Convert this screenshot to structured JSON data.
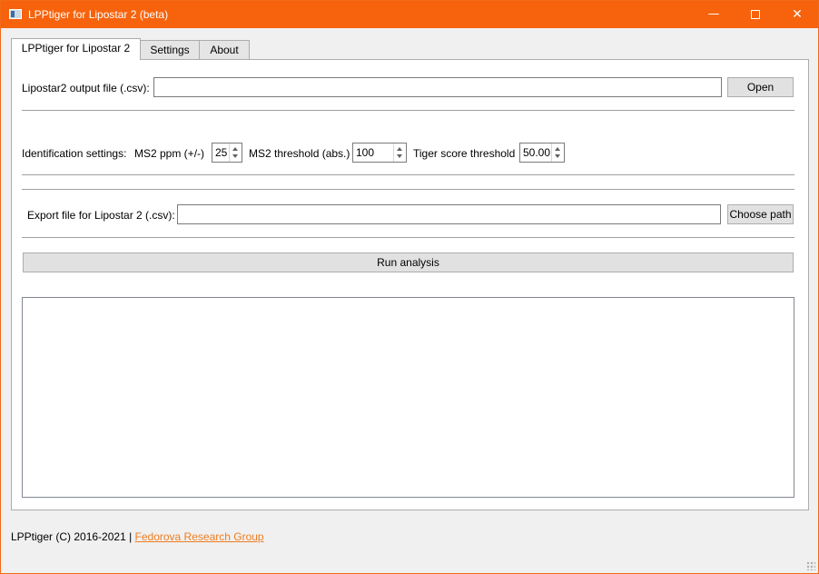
{
  "window": {
    "title": "LPPtiger for Lipostar 2 (beta)",
    "controls": {
      "minimize": "—",
      "close": "✕"
    },
    "accent_color": "#f7630c"
  },
  "tabs": [
    {
      "label": "LPPtiger for Lipostar 2",
      "active": true
    },
    {
      "label": "Settings",
      "active": false
    },
    {
      "label": "About",
      "active": false
    }
  ],
  "input_section": {
    "file_label": "Lipostar2 output file (.csv):",
    "file_value": "",
    "open_button": "Open"
  },
  "identification": {
    "label": "Identification settings:",
    "ppm_label": "MS2 ppm (+/-)",
    "ppm_value": "25",
    "threshold_label": "MS2 threshold (abs.)",
    "threshold_value": "100",
    "tiger_label": "Tiger score threshold",
    "tiger_value": "50.00"
  },
  "export_section": {
    "file_label": "Export file for Lipostar 2 (.csv):",
    "file_value": "",
    "choose_button": "Choose path"
  },
  "run_button": "Run analysis",
  "log_text": "",
  "footer": {
    "text": "LPPtiger (C) 2016-2021 | ",
    "link": "Fedorova Research Group",
    "link_color": "#ef7d1f"
  }
}
